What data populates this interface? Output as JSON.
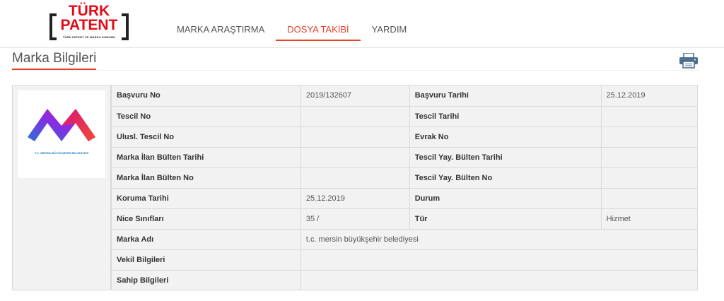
{
  "logo": {
    "line1": "TÜRK",
    "line2": "PATENT",
    "subtitle": "TÜRK PATENT VE MARKA KURUMU"
  },
  "nav": {
    "items": [
      {
        "label": "MARKA ARAŞTIRMA"
      },
      {
        "label": "DOSYA TAKİBİ"
      },
      {
        "label": "YARDIM"
      }
    ],
    "active_index": 1
  },
  "section": {
    "title": "Marka Bilgileri",
    "print_icon": "printer-icon"
  },
  "mark_image": {
    "caption": "T.C. MERSİN BÜYÜKŞEHİR BELEDİYESİ"
  },
  "details": {
    "rows": [
      {
        "l1": "Başvuru No",
        "v1": "2019/132607",
        "l2": "Başvuru Tarihi",
        "v2": "25.12.2019"
      },
      {
        "l1": "Tescil No",
        "v1": "",
        "l2": "Tescil Tarihi",
        "v2": ""
      },
      {
        "l1": "Ulusl. Tescil No",
        "v1": "",
        "l2": "Evrak No",
        "v2": ""
      },
      {
        "l1": "Marka İlan Bülten Tarihi",
        "v1": "",
        "l2": "Tescil Yay. Bülten Tarihi",
        "v2": ""
      },
      {
        "l1": "Marka İlan Bülten No",
        "v1": "",
        "l2": "Tescil Yay. Bülten No",
        "v2": ""
      },
      {
        "l1": "Koruma Tarihi",
        "v1": "25.12.2019",
        "l2": "Durum",
        "v2": ""
      },
      {
        "l1": "Nice Sınıfları",
        "v1": "35 /",
        "l2": "Tür",
        "v2": "Hizmet"
      }
    ],
    "marka_adi_label": "Marka Adı",
    "marka_adi": "t.c. mersin büyükşehir belediyesi",
    "vekil_label": "Vekil Bilgileri",
    "vekil": "",
    "sahip_label": "Sahip Bilgileri",
    "sahip": ""
  },
  "colors": {
    "accent": "#e3432b",
    "brand_red": "#e30a17",
    "table_bg": "#f2f2f2",
    "border": "#d9d9d9"
  }
}
